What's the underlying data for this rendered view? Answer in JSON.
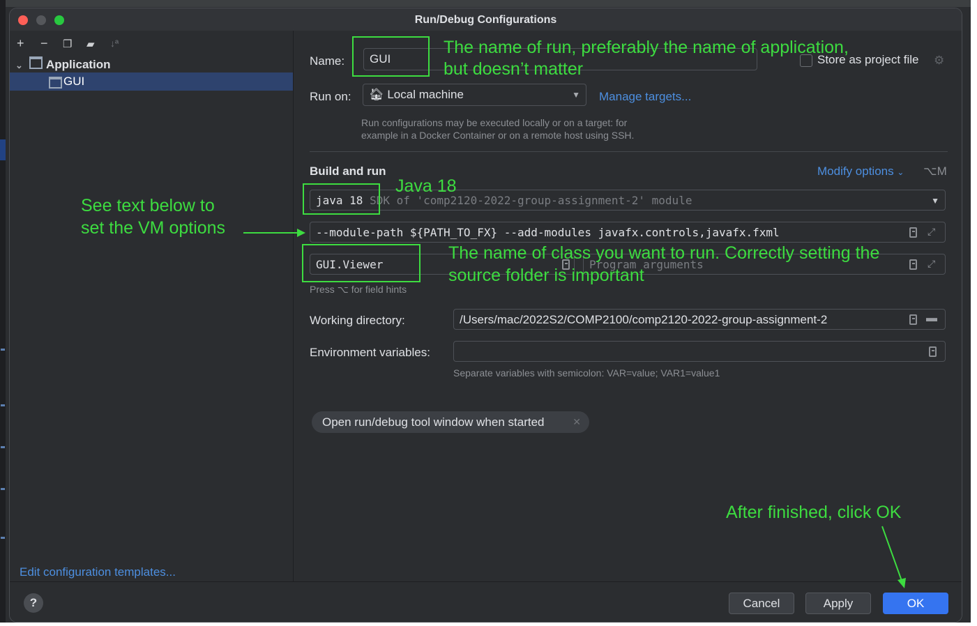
{
  "window": {
    "title": "Run/Debug Configurations"
  },
  "left": {
    "tree": {
      "group": "Application",
      "selected_item": "GUI"
    },
    "edit_templates": "Edit configuration templates..."
  },
  "form": {
    "name_label": "Name:",
    "name_value": "GUI",
    "store_as_project_file": "Store as project file",
    "run_on_label": "Run on:",
    "run_on_value": "Local machine",
    "manage_targets": "Manage targets...",
    "run_on_hint_1": "Run configurations may be executed locally or on a target: for",
    "run_on_hint_2": "example in a Docker Container or on a remote host using SSH.",
    "build_and_run": "Build and run",
    "modify_options": "Modify options",
    "modify_options_shortcut": "⌥M",
    "jdk_value": "java 18",
    "jdk_hint": "SDK of 'comp2120-2022-group-assignment-2' module",
    "vm_options": "--module-path ${PATH_TO_FX} --add-modules javafx.controls,javafx.fxml",
    "main_class": "GUI.Viewer",
    "program_args_placeholder": "Program arguments",
    "field_hints": "Press ⌥ for field hints",
    "working_dir_label": "Working directory:",
    "working_dir_value": "/Users/mac/2022S2/COMP2100/comp2120-2022-group-assignment-2",
    "env_label": "Environment variables:",
    "env_value": "",
    "env_hint": "Separate variables with semicolon: VAR=value; VAR1=value1",
    "chip": "Open run/debug tool window when started"
  },
  "buttons": {
    "help": "?",
    "cancel": "Cancel",
    "apply": "Apply",
    "ok": "OK"
  },
  "annotations": {
    "name_1": "The name of run, preferably the name of application,",
    "name_2": "but doesn’t matter",
    "java": "Java 18",
    "vm_1": "See text below to",
    "vm_2": "set the VM options",
    "class_1": "The name of class you want to run. Correctly setting the",
    "class_2": "source folder is important",
    "ok": "After finished, click OK"
  },
  "colors": {
    "annotation": "#3ddc40",
    "accent": "#3574f0",
    "link": "#4d8fe0",
    "background": "#2b2d30"
  }
}
